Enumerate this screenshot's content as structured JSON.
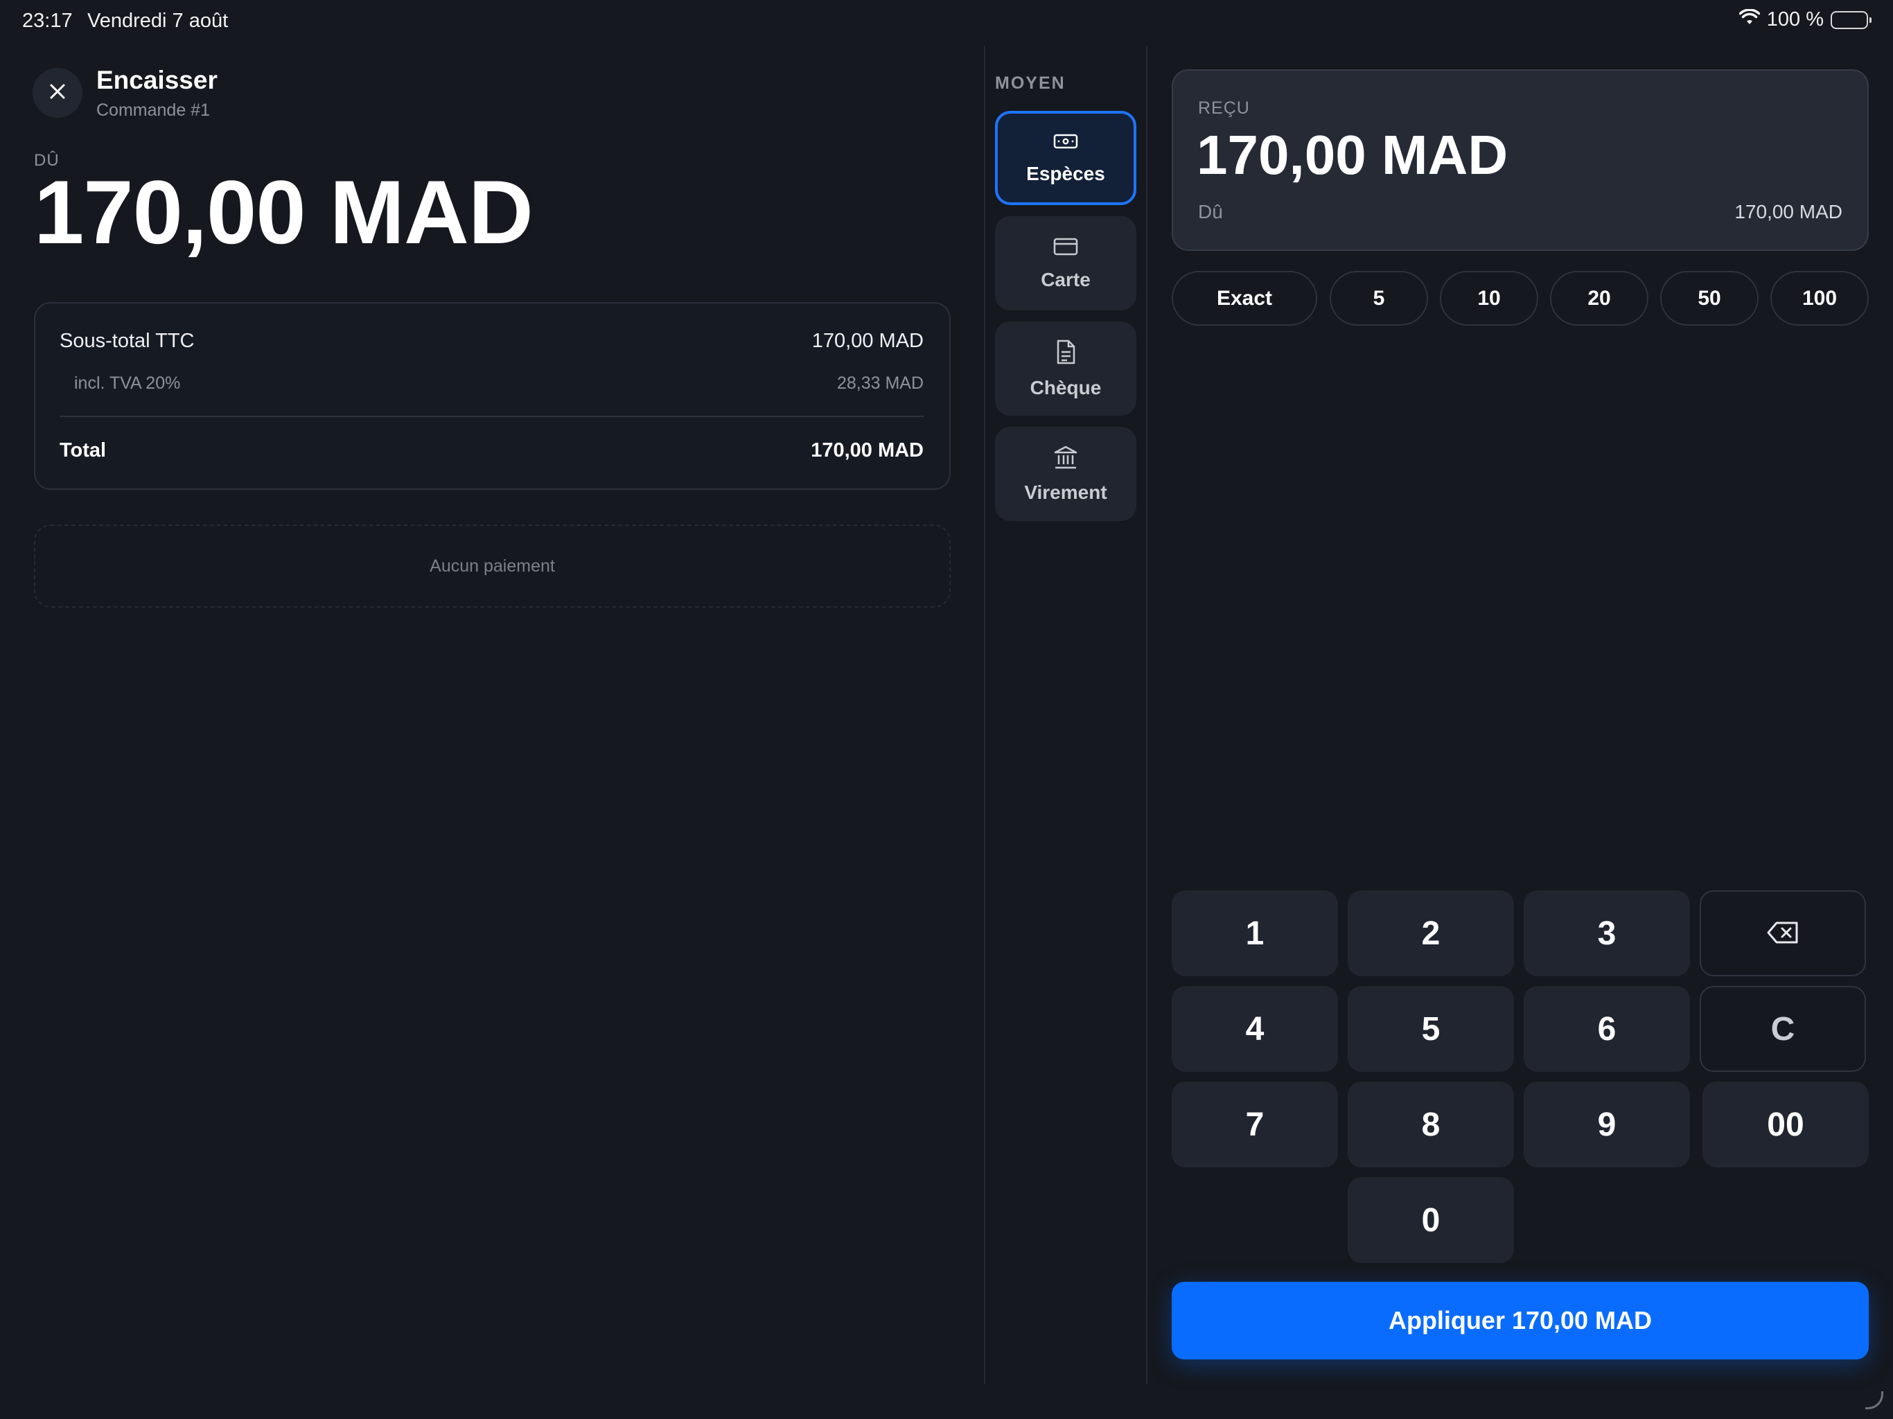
{
  "status_bar": {
    "time": "23:17",
    "date": "Vendredi 7 août",
    "battery_text": "100 %"
  },
  "header": {
    "title": "Encaisser",
    "subtitle": "Commande #1"
  },
  "due": {
    "label": "DÛ",
    "amount": "170,00 MAD"
  },
  "summary": {
    "subtotal_label": "Sous-total TTC",
    "subtotal_value": "170,00 MAD",
    "tax_label": "incl. TVA 20%",
    "tax_value": "28,33 MAD",
    "total_label": "Total",
    "total_value": "170,00 MAD"
  },
  "payments": {
    "empty_text": "Aucun paiement"
  },
  "methods": {
    "label": "MOYEN",
    "items": [
      {
        "label": "Espèces",
        "icon": "cash-icon",
        "selected": true
      },
      {
        "label": "Carte",
        "icon": "card-icon",
        "selected": false
      },
      {
        "label": "Chèque",
        "icon": "document-icon",
        "selected": false
      },
      {
        "label": "Virement",
        "icon": "bank-icon",
        "selected": false
      }
    ]
  },
  "received": {
    "label": "REÇU",
    "amount": "170,00 MAD",
    "due_label": "Dû",
    "due_value": "170,00 MAD"
  },
  "quick_amounts": [
    "Exact",
    "5",
    "10",
    "20",
    "50",
    "100"
  ],
  "keypad": {
    "keys": [
      "1",
      "2",
      "3",
      "4",
      "5",
      "6",
      "7",
      "8",
      "9",
      "00",
      "0"
    ],
    "clear": "C",
    "backspace_icon": "backspace-icon"
  },
  "apply_button": "Appliquer 170,00 MAD",
  "colors": {
    "background": "#15181e",
    "accent": "#0a6cff",
    "selected_method_bg": "#122038",
    "key_bg": "#212530"
  }
}
